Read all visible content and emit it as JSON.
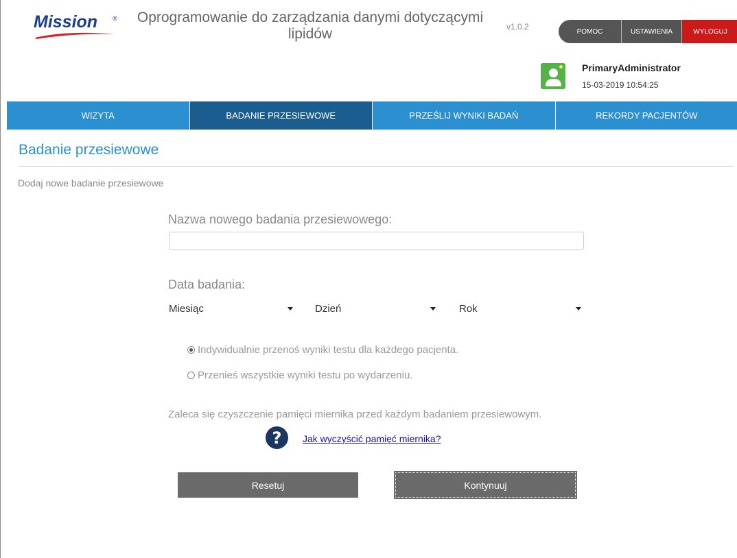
{
  "brand": {
    "logo_text": "Mission",
    "logo_mark": "®",
    "logo_color": "#1c3f8c",
    "swoosh_color": "#d91f26"
  },
  "header": {
    "app_title": "Oprogramowanie do zarządzania danymi dotyczącymi lipidów",
    "version": "v1.0.2",
    "nav": {
      "help": "POMOC",
      "settings": "USTAWIENIA",
      "logout": "WYLOGUJ"
    }
  },
  "user": {
    "name": "PrimaryAdministrator",
    "datetime": "15-03-2019 10:54:25",
    "avatar_icon": "user-avatar-icon"
  },
  "main_nav": {
    "items": [
      {
        "label": "WIZYTA",
        "active": false
      },
      {
        "label": "BADANIE PRZESIEWOWE",
        "active": true
      },
      {
        "label": "PRZEŚLIJ WYNIKI BADAŃ",
        "active": false
      },
      {
        "label": "REKORDY PACJENTÓW",
        "active": false
      }
    ],
    "color": "#2b8fd0",
    "active_color": "#1b5d8e"
  },
  "page": {
    "title": "Badanie przesiewowe",
    "subtitle": "Dodaj nowe badanie przesiewowe"
  },
  "form": {
    "name_label": "Nazwa nowego badania przesiewowego:",
    "name_value": "",
    "date_label": "Data badania:",
    "month_select": "Miesiąc",
    "day_select": "Dzień",
    "year_select": "Rok",
    "radio_individual": "Indywidualnie przenoś wyniki testu dla każdego pacjenta.",
    "radio_individual_checked": true,
    "radio_all": "Przenieś wszystkie wyniki testu po wydarzeniu.",
    "radio_all_checked": false,
    "recommendation": "Zaleca się czyszczenie pamięci miernika przed każdym badaniem przesiewowym.",
    "help_icon_glyph": "?",
    "help_link": "Jak wyczyścić pamięć miernika?",
    "reset_button": "Resetuj",
    "continue_button": "Kontynuuj"
  }
}
